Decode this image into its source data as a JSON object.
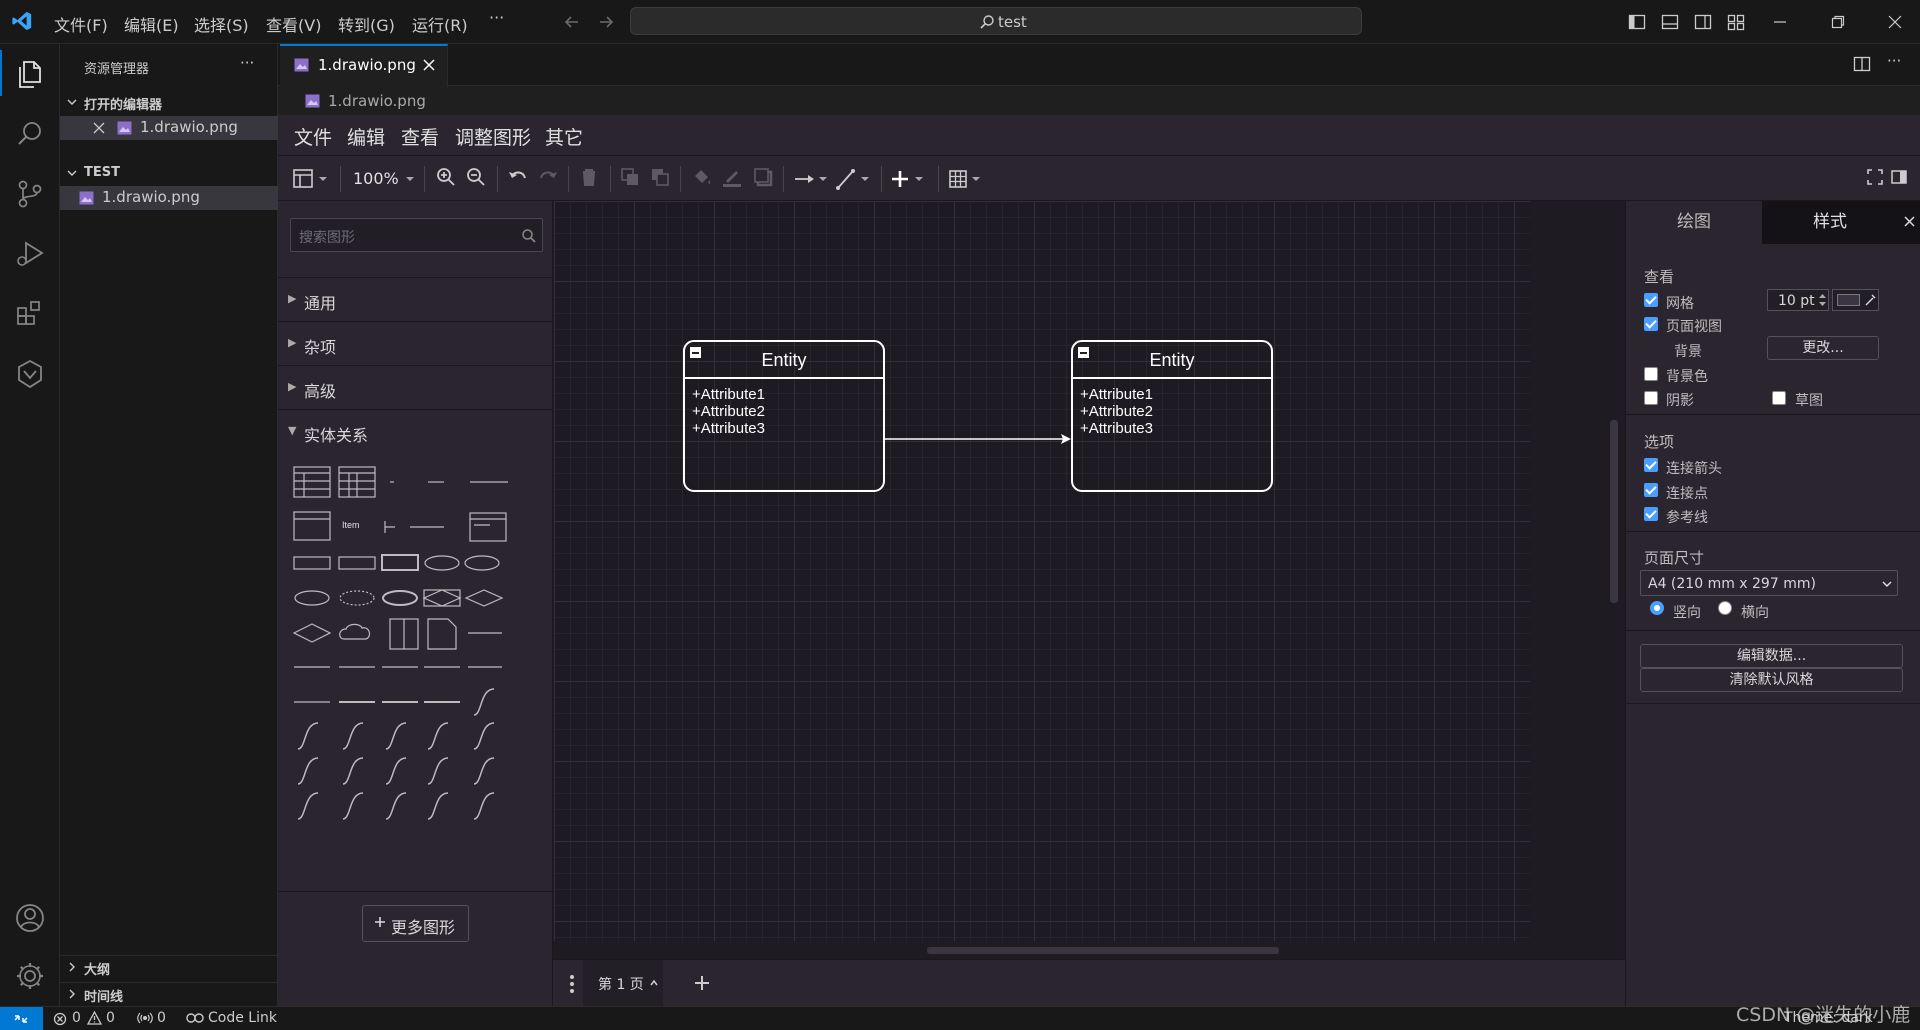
{
  "titlebar": {
    "menus": [
      "文件(F)",
      "编辑(E)",
      "选择(S)",
      "查看(V)",
      "转到(G)",
      "运行(R)"
    ],
    "more": "···",
    "search_text": "test"
  },
  "explorer": {
    "title": "资源管理器",
    "more": "···",
    "open_editors": "打开的编辑器",
    "open_file": "1.drawio.png",
    "folder": "TEST",
    "file": "1.drawio.png",
    "outline": "大纲",
    "timeline": "时间线"
  },
  "editor": {
    "tab_label": "1.drawio.png",
    "breadcrumb": "1.drawio.png"
  },
  "drawio": {
    "menus": [
      "文件",
      "编辑",
      "查看",
      "调整图形",
      "其它"
    ],
    "zoom": "100%",
    "search_placeholder": "搜索图形",
    "categories": [
      "通用",
      "杂项",
      "高级",
      "实体关系"
    ],
    "shape_item_label": "Item",
    "more_shapes": "更多图形",
    "page_tab": "第 1 页",
    "entities": [
      {
        "name": "Entity",
        "attributes": [
          "+Attribute1",
          "+Attribute2",
          "+Attribute3"
        ]
      },
      {
        "name": "Entity",
        "attributes": [
          "+Attribute1",
          "+Attribute2",
          "+Attribute3"
        ]
      }
    ],
    "format_panel": {
      "tab_diagram": "绘图",
      "tab_style": "样式",
      "view_title": "查看",
      "grid": "网格",
      "grid_size": "10 pt",
      "page_view": "页面视图",
      "background": "背景",
      "change_btn": "更改...",
      "background_color": "背景色",
      "shadow": "阴影",
      "sketch": "草图",
      "options_title": "选项",
      "connection_arrows": "连接箭头",
      "connection_points": "连接点",
      "guides": "参考线",
      "page_size_title": "页面尺寸",
      "page_size_value": "A4 (210 mm x 297 mm)",
      "portrait": "竖向",
      "landscape": "横向",
      "edit_data_btn": "编辑数据...",
      "clear_style_btn": "清除默认风格"
    }
  },
  "statusbar": {
    "errors": "0",
    "warnings": "0",
    "ports": "0",
    "code_link": "Code Link",
    "theme": "Theme: dark"
  },
  "watermark": "CSDN @迷失的小鹿",
  "colors": {
    "accent": "#0078d4",
    "checkbox": "#4a9eff"
  }
}
